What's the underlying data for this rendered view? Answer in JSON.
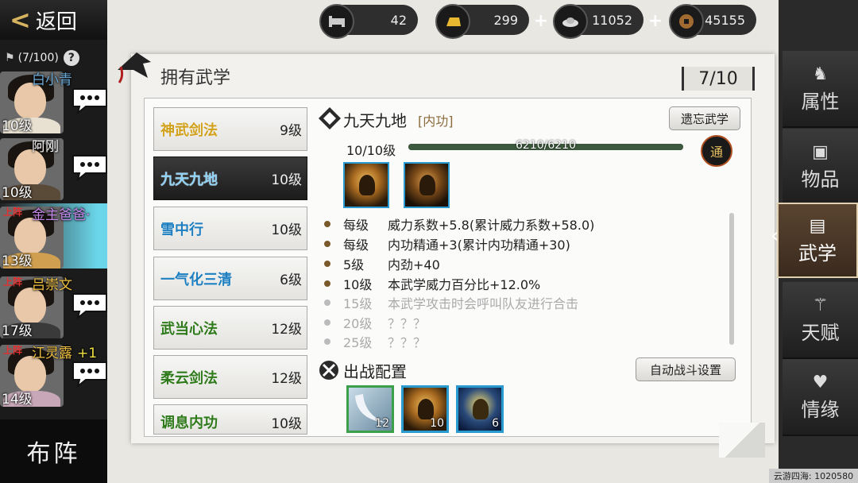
{
  "header": {
    "back_label": "返回",
    "sect_count": "(7/100)",
    "help": "?"
  },
  "resources": [
    {
      "name": "stamina",
      "icon": "bed-icon",
      "value": "42",
      "has_plus": false
    },
    {
      "name": "gold",
      "icon": "gold-bar-icon",
      "value": "299",
      "has_plus": true
    },
    {
      "name": "silver",
      "icon": "silver-ingot-icon",
      "value": "11052",
      "has_plus": true
    },
    {
      "name": "copper",
      "icon": "coin-icon",
      "value": "45155",
      "has_plus": false
    }
  ],
  "characters": [
    {
      "name": "白小青",
      "level": "10级",
      "on_duty": "",
      "bonus": "",
      "color": "#6aa9d8"
    },
    {
      "name": "阿刚",
      "level": "10级",
      "on_duty": "",
      "bonus": "",
      "color": "#ffffff"
    },
    {
      "name": "金主爸爸·",
      "level": "13级",
      "on_duty": "上阵",
      "bonus": "",
      "color": "#c486e8"
    },
    {
      "name": "吕崇文",
      "level": "17级",
      "on_duty": "上阵",
      "bonus": "",
      "color": "#f0c040"
    },
    {
      "name": "江灵露",
      "level": "14级",
      "on_duty": "上阵",
      "bonus": "+1",
      "color": "#f0c040"
    }
  ],
  "formation_label": "布阵",
  "panel": {
    "title": "拥有武学",
    "count": "7/10"
  },
  "skills": [
    {
      "name": "神武剑法",
      "level": "9级",
      "color": "yellow"
    },
    {
      "name": "九天九地",
      "level": "10级",
      "color": "blue",
      "selected": true
    },
    {
      "name": "雪中行",
      "level": "10级",
      "color": "blue"
    },
    {
      "name": "一气化三清",
      "level": "6级",
      "color": "blue"
    },
    {
      "name": "武当心法",
      "level": "12级",
      "color": "green"
    },
    {
      "name": "柔云剑法",
      "level": "12级",
      "color": "green"
    },
    {
      "name": "调息内功",
      "level": "10级",
      "color": "green"
    }
  ],
  "detail": {
    "name": "九天九地",
    "type": "[内功]",
    "forget_label": "遗忘武学",
    "level_text": "10/10级",
    "exp_text": "6210/6210",
    "exp_fraction": 1.0,
    "tong_label": "通",
    "effects": [
      {
        "level": "每级",
        "text": "威力系数+5.8(累计威力系数+58.0)",
        "active": true
      },
      {
        "level": "每级",
        "text": "内功精通+3(累计内功精通+30)",
        "active": true
      },
      {
        "level": "5级",
        "text": "内劲+40",
        "active": true
      },
      {
        "level": "10级",
        "text": "本武学威力百分比+12.0%",
        "active": true
      },
      {
        "level": "15级",
        "text": "本武学攻击时会呼叫队友进行合击",
        "active": false
      },
      {
        "level": "20级",
        "text": "？？？",
        "active": false
      },
      {
        "level": "25级",
        "text": "？？？",
        "active": false
      }
    ],
    "battle_title": "出战配置",
    "auto_label": "自动战斗设置",
    "battle_slots": [
      {
        "icon": "moon-slash-icon",
        "count": "12",
        "border": "#3ca04a"
      },
      {
        "icon": "meditating-monk-icon",
        "count": "10",
        "border": "#2a9bd0"
      },
      {
        "icon": "warrior-icon",
        "count": "6",
        "border": "#2a9bd0"
      }
    ]
  },
  "tabs": [
    {
      "label": "属性",
      "icon": "horse-icon"
    },
    {
      "label": "物品",
      "icon": "box-icon"
    },
    {
      "label": "武学",
      "icon": "book-icon",
      "active": true
    },
    {
      "label": "天赋",
      "icon": "branch-icon"
    },
    {
      "label": "情缘",
      "icon": "heart-icon"
    }
  ],
  "watermark": "云游四海: 1020580"
}
